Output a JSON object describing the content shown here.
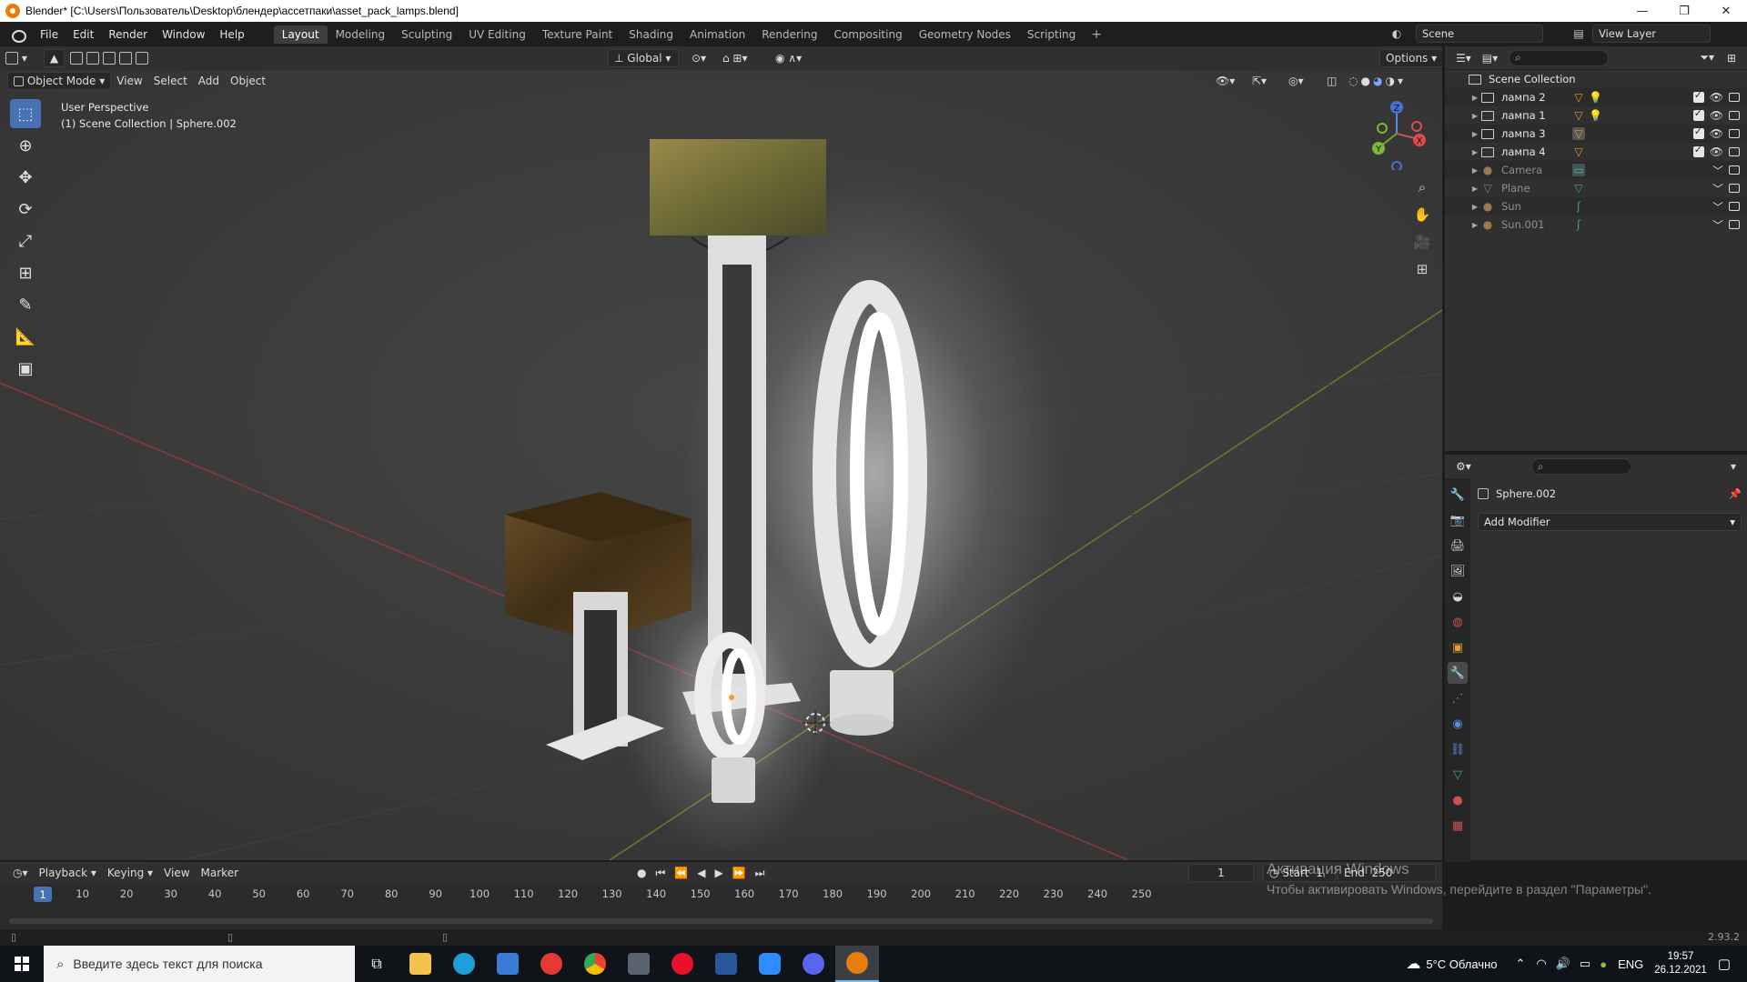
{
  "window": {
    "title": "Blender* [C:\\Users\\Пользователь\\Desktop\\блендер\\ассетпаки\\asset_pack_lamps.blend]",
    "controls": [
      "—",
      "❐",
      "✕"
    ]
  },
  "menu": {
    "items": [
      "File",
      "Edit",
      "Render",
      "Window",
      "Help"
    ]
  },
  "workspaces": {
    "tabs": [
      "Layout",
      "Modeling",
      "Sculpting",
      "UV Editing",
      "Texture Paint",
      "Shading",
      "Animation",
      "Rendering",
      "Compositing",
      "Geometry Nodes",
      "Scripting"
    ],
    "active": "Layout",
    "add": "+"
  },
  "scene": {
    "name": "Scene",
    "view_layer": "View Layer"
  },
  "viewport": {
    "mode": "Object Mode",
    "menus": [
      "View",
      "Select",
      "Add",
      "Object"
    ],
    "transform_orientation": "Global",
    "options_label": "Options",
    "info_line1": "User Perspective",
    "info_line2": "(1) Scene Collection | Sphere.002",
    "gizmo": {
      "x": "X",
      "y": "Y",
      "z": "Z"
    }
  },
  "outliner": {
    "root": "Scene Collection",
    "rows": [
      {
        "name": "лампа 2",
        "dim": false
      },
      {
        "name": "лампа 1",
        "dim": false
      },
      {
        "name": "лампа 3",
        "dim": false
      },
      {
        "name": "лампа 4",
        "dim": false
      },
      {
        "name": "Camera",
        "dim": true
      },
      {
        "name": "Plane",
        "dim": true
      },
      {
        "name": "Sun",
        "dim": true
      },
      {
        "name": "Sun.001",
        "dim": true
      }
    ]
  },
  "properties": {
    "object_name": "Sphere.002",
    "add_modifier": "Add Modifier"
  },
  "timeline": {
    "menus": [
      "Playback",
      "Keying",
      "View",
      "Marker"
    ],
    "current_frame": "1",
    "start_label": "Start",
    "start_value": "1",
    "end_label": "End",
    "end_value": "250",
    "ruler": [
      "1",
      "10",
      "20",
      "30",
      "40",
      "50",
      "60",
      "70",
      "80",
      "90",
      "100",
      "110",
      "120",
      "130",
      "140",
      "150",
      "160",
      "170",
      "180",
      "190",
      "200",
      "210",
      "220",
      "230",
      "240",
      "250"
    ]
  },
  "status": {
    "version": "2.93.2"
  },
  "watermark": {
    "line1": "Активация Windows",
    "line2": "Чтобы активировать Windows, перейдите в раздел \"Параметры\"."
  },
  "taskbar": {
    "search_placeholder": "Введите здесь текст для поиска",
    "weather": "5°C  Облачно",
    "lang": "ENG",
    "time": "19:57",
    "date": "26.12.2021"
  }
}
